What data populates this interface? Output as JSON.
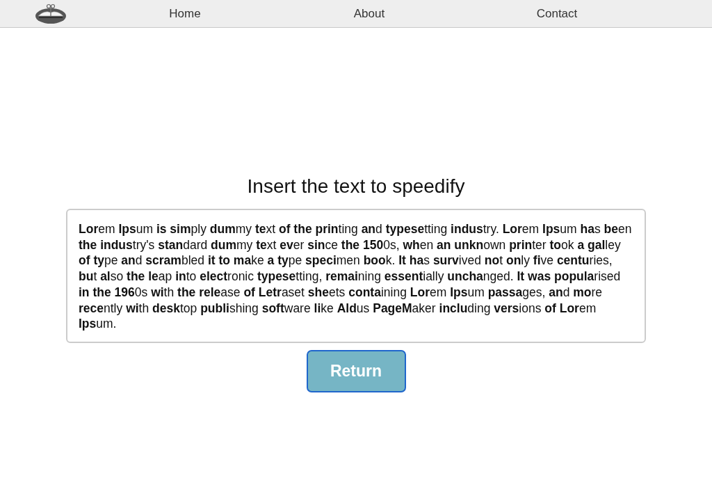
{
  "nav": {
    "links": [
      "Home",
      "About",
      "Contact"
    ]
  },
  "heading": "Insert the text to speedify",
  "text": "**Lor**em **Ips**um **is** **sim**ply **dum**my **te**xt **of** **the** **prin**ting **an**d **typese**tting **indus**try. **Lor**em **Ips**um **ha**s **be**en **the** **indus**try's **stan**dard **dum**my **te**xt **ev**er **sin**ce **the** **150**0s, **wh**en **an** **unkn**own **prin**ter **to**ok **a** **gal**ley **of** **ty**pe **an**d **scram**bled **it** **to** **ma**ke **a** **ty**pe **speci**men **boo**k. **It** **ha**s **surv**ived **no**t **on**ly **fi**ve **centu**ries, **bu**t **al**so **the** **le**ap **in**to **elect**ronic **typese**tting, **remai**ning **essent**ially **uncha**nged. **It** **was** **popula**rised **in** **the** **196**0s **wi**th **the** **rele**ase **of** **Letr**aset **she**ets **conta**ining **Lor**em **Ips**um **passa**ges, **an**d **mo**re **rece**ntly **wi**th **desk**top **publi**shing **soft**ware **li**ke **Ald**us **PageM**aker **inclu**ding **vers**ions **of** **Lor**em **Ips**um.",
  "button": "Return"
}
